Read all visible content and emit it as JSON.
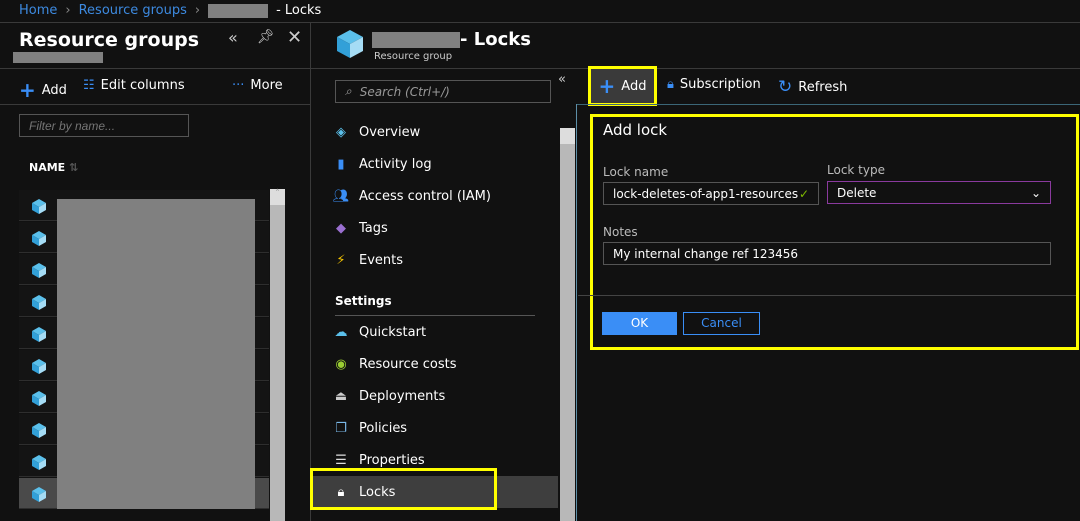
{
  "breadcrumb": {
    "home": "Home",
    "groups": "Resource groups",
    "current": "- Locks"
  },
  "left": {
    "title": "Resource groups",
    "add": "Add",
    "edit_columns": "Edit columns",
    "more": "More",
    "filter_placeholder": "Filter by name...",
    "name_col": "NAME",
    "rows": 10
  },
  "middle": {
    "title": "- Locks",
    "subtitle": "Resource group",
    "search_placeholder": "Search (Ctrl+/)",
    "items": [
      {
        "label": "Overview",
        "icon": "cube-icon"
      },
      {
        "label": "Activity log",
        "icon": "log-icon"
      },
      {
        "label": "Access control (IAM)",
        "icon": "users-icon"
      },
      {
        "label": "Tags",
        "icon": "tag-icon"
      },
      {
        "label": "Events",
        "icon": "lightning-icon"
      }
    ],
    "settings_heading": "Settings",
    "settings": [
      {
        "label": "Quickstart",
        "icon": "cloud-icon"
      },
      {
        "label": "Resource costs",
        "icon": "costs-icon"
      },
      {
        "label": "Deployments",
        "icon": "deploy-icon"
      },
      {
        "label": "Policies",
        "icon": "policy-icon"
      },
      {
        "label": "Properties",
        "icon": "list-icon"
      },
      {
        "label": "Locks",
        "icon": "lock-icon"
      }
    ]
  },
  "toolbar": {
    "add": "Add",
    "subscription": "Subscription",
    "refresh": "Refresh"
  },
  "form": {
    "title": "Add lock",
    "lock_name_label": "Lock name",
    "lock_name": "lock-deletes-of-app1-resources",
    "lock_type_label": "Lock type",
    "lock_type": "Delete",
    "notes_label": "Notes",
    "notes": "My internal change ref 123456",
    "ok": "OK",
    "cancel": "Cancel"
  },
  "colors": {
    "accent": "#3a8ef6",
    "highlight": "#ffff00",
    "link": "#3d8ae0"
  }
}
